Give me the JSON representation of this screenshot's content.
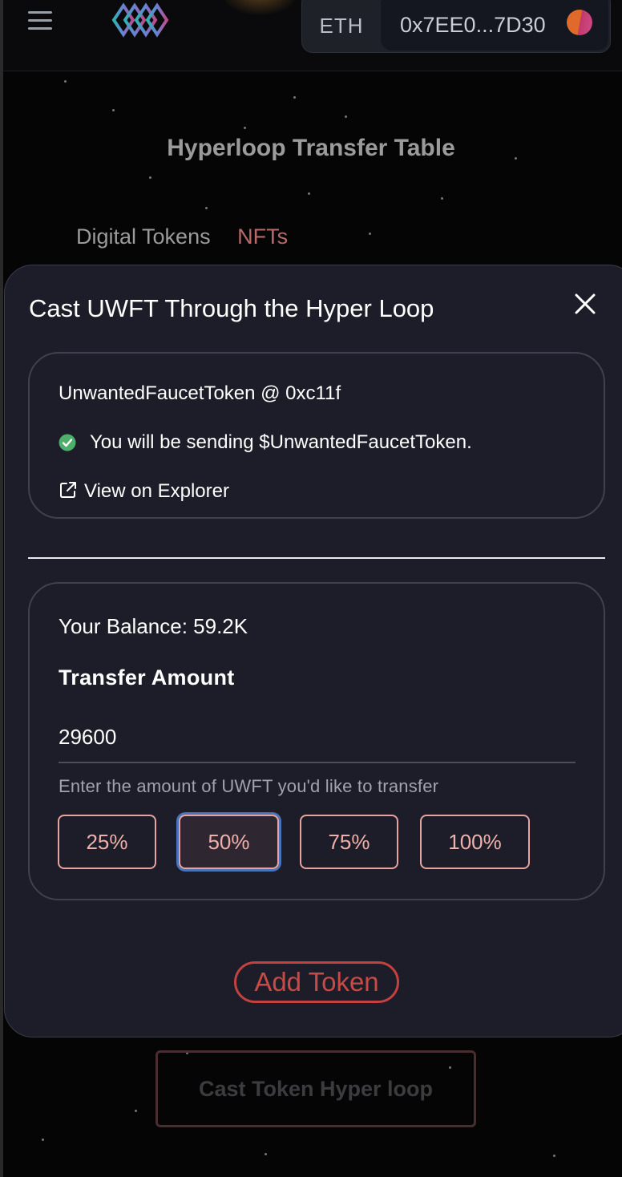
{
  "header": {
    "chain": "ETH",
    "account": "0x7EE0...7D30"
  },
  "page": {
    "title": "Hyperloop Transfer Table",
    "tabs": [
      "Digital Tokens",
      "NFTs"
    ]
  },
  "modal": {
    "title": "Cast UWFT Through the Hyper Loop",
    "token_info": {
      "name_line": "UnwantedFaucetToken @ 0xc11f",
      "confirm_line": "You will be sending $UnwantedFaucetToken.",
      "explorer_link": "View on Explorer"
    },
    "transfer": {
      "balance": "Your Balance: 59.2K",
      "label": "Transfer Amount",
      "amount": "29600",
      "helper": "Enter the amount of UWFT you'd like to transfer",
      "percent_options": [
        "25%",
        "50%",
        "75%",
        "100%"
      ],
      "selected_percent": "50%"
    },
    "add_token": "Add Token"
  },
  "footer": {
    "cast_button": "Cast Token Hyper loop"
  },
  "colors": {
    "modal_bg": "#1c1d28",
    "accent_red": "#c2423f",
    "pct_border": "#e8a3a0",
    "selected_ring": "#4a74b8",
    "success_green": "#4caf6a"
  },
  "icons": [
    "menu-icon",
    "logo-icon",
    "close-icon",
    "check-circle-icon",
    "external-link-icon"
  ]
}
